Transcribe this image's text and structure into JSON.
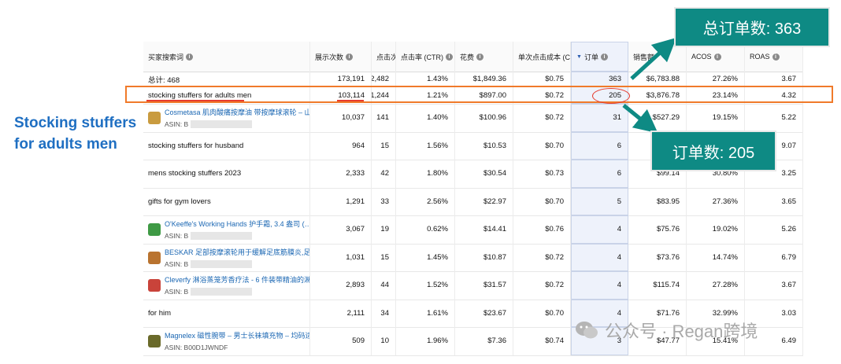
{
  "caption": "Stocking stuffers for adults men",
  "columns": [
    {
      "label": "买家搜索词",
      "info": "i"
    },
    {
      "label": "展示次数",
      "info": "i"
    },
    {
      "label": "点击次数",
      "info": ""
    },
    {
      "label": "点击率 (CTR)",
      "info": "i"
    },
    {
      "label": "花费",
      "info": "i"
    },
    {
      "label": "单次点击成本 (CPC)",
      "info": ""
    },
    {
      "label": "订单",
      "info": "i",
      "sort": "▼"
    },
    {
      "label": "销售额",
      "info": ""
    },
    {
      "label": "ACOS",
      "info": "i"
    },
    {
      "label": "ROAS",
      "info": "i"
    }
  ],
  "total": {
    "term": "总计: 468",
    "impressions": "173,191",
    "clicks": "2,482",
    "ctr": "1.43%",
    "spend": "$1,849.36",
    "cpc": "$0.75",
    "orders": "363",
    "sales": "$6,783.88",
    "acos": "27.26%",
    "roas": "3.67"
  },
  "highlight": {
    "term": "stocking stuffers for adults men",
    "impressions": "103,114",
    "clicks": "1,244",
    "ctr": "1.21%",
    "spend": "$897.00",
    "cpc": "$0.72",
    "orders": "205",
    "sales": "$3,876.78",
    "acos": "23.14%",
    "roas": "4.32"
  },
  "rows": [
    {
      "type": "product",
      "term": "Cosmetasa 肌肉酸痛按摩油 带按摩球滚轮 – 山…",
      "asin": "ASIN: B",
      "thumb": "#c99b3f",
      "impressions": "10,037",
      "clicks": "141",
      "ctr": "1.40%",
      "spend": "$100.96",
      "cpc": "$0.72",
      "orders": "31",
      "sales": "$527.29",
      "acos": "19.15%",
      "roas": "5.22"
    },
    {
      "type": "text",
      "term": "stocking stuffers for husband",
      "impressions": "964",
      "clicks": "15",
      "ctr": "1.56%",
      "spend": "$10.53",
      "cpc": "$0.70",
      "orders": "6",
      "sales": "",
      "acos": "",
      "roas": "9.07"
    },
    {
      "type": "text",
      "term": "mens stocking stuffers 2023",
      "impressions": "2,333",
      "clicks": "42",
      "ctr": "1.80%",
      "spend": "$30.54",
      "cpc": "$0.73",
      "orders": "6",
      "sales": "$99.14",
      "acos": "30.80%",
      "roas": "3.25"
    },
    {
      "type": "text",
      "term": "gifts for gym lovers",
      "impressions": "1,291",
      "clicks": "33",
      "ctr": "2.56%",
      "spend": "$22.97",
      "cpc": "$0.70",
      "orders": "5",
      "sales": "$83.95",
      "acos": "27.36%",
      "roas": "3.65"
    },
    {
      "type": "product",
      "term": "O'Keeffe's Working Hands 护手霜, 3.4 盎司 (…",
      "asin": "ASIN: B",
      "thumb": "#3f9a45",
      "impressions": "3,067",
      "clicks": "19",
      "ctr": "0.62%",
      "spend": "$14.41",
      "cpc": "$0.76",
      "orders": "4",
      "sales": "$75.76",
      "acos": "19.02%",
      "roas": "5.26"
    },
    {
      "type": "product",
      "term": "BESKAR 足部按摩滚轮用于缓解足底筋膜炎,足部…",
      "asin": "ASIN: B",
      "thumb": "#b9732f",
      "impressions": "1,031",
      "clicks": "15",
      "ctr": "1.45%",
      "spend": "$10.87",
      "cpc": "$0.72",
      "orders": "4",
      "sales": "$73.76",
      "acos": "14.74%",
      "roas": "6.79"
    },
    {
      "type": "product",
      "term": "Cleverfy 淋浴蒸笼芳香疗法 - 6 件装带精油的淋…",
      "asin": "ASIN: B",
      "thumb": "#c9433a",
      "impressions": "2,893",
      "clicks": "44",
      "ctr": "1.52%",
      "spend": "$31.57",
      "cpc": "$0.72",
      "orders": "4",
      "sales": "$115.74",
      "acos": "27.28%",
      "roas": "3.67"
    },
    {
      "type": "text",
      "term": "for him",
      "impressions": "2,111",
      "clicks": "34",
      "ctr": "1.61%",
      "spend": "$23.67",
      "cpc": "$0.70",
      "orders": "4",
      "sales": "$71.76",
      "acos": "32.99%",
      "roas": "3.03"
    },
    {
      "type": "product",
      "term": "Magnelex 磁性腕带 – 男士长袜填充物 – 均码适…",
      "asin": "ASIN: B00D1JWNDF",
      "thumb": "#6a6a2a",
      "impressions": "509",
      "clicks": "10",
      "ctr": "1.96%",
      "spend": "$7.36",
      "cpc": "$0.74",
      "orders": "3",
      "sales": "$47.77",
      "acos": "15.41%",
      "roas": "6.49"
    }
  ],
  "callout_total": "总订单数: 363",
  "callout_row": "订单数: 205",
  "watermark": "公众号 · Regan跨境",
  "colors": {
    "teal": "#0e8a84",
    "orange": "#f07a2a",
    "red": "#e63b2e",
    "link": "#1b67b3",
    "caption": "#1f6fc2"
  }
}
